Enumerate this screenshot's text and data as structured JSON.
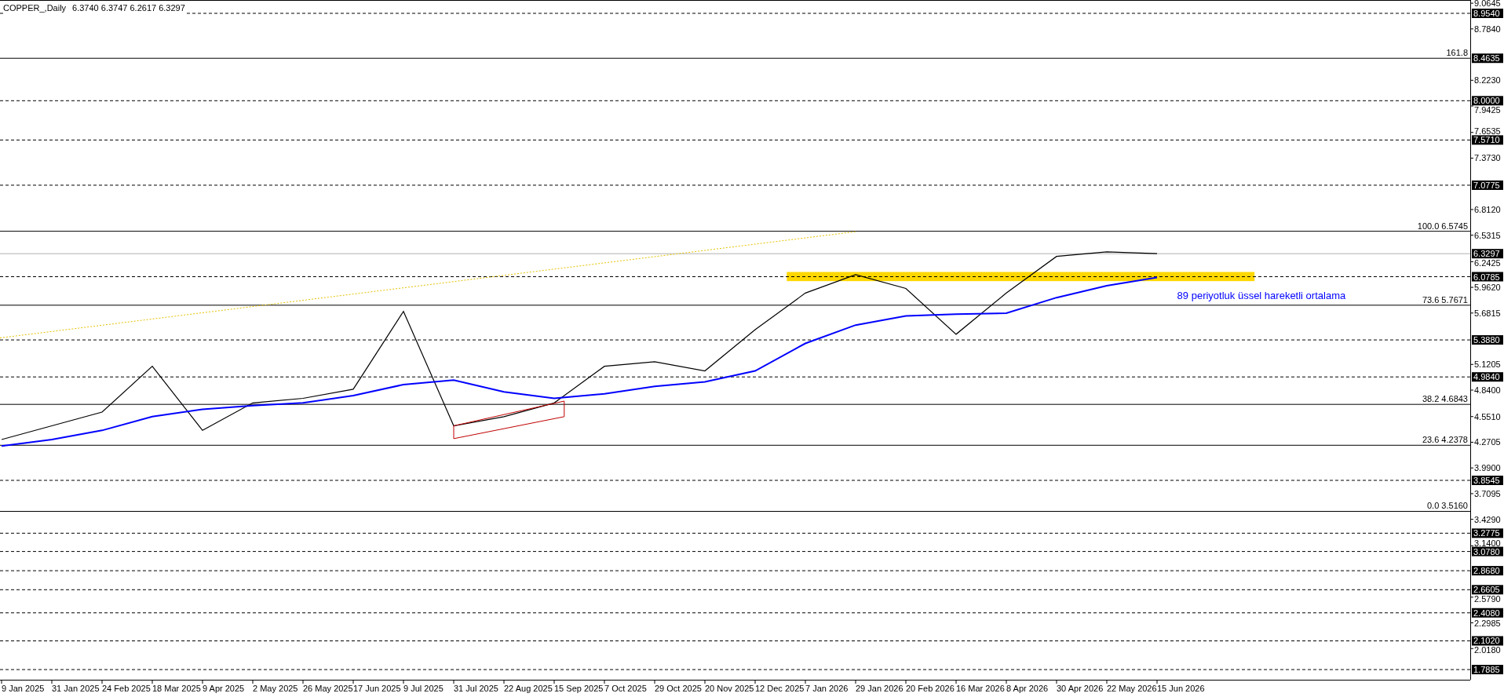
{
  "header": {
    "symbol": "COPPER_,Daily",
    "ohlc": "6.3740 6.3747 6.2617 6.3297"
  },
  "chart_data": {
    "type": "line",
    "categories": [
      "9 Jan 2025",
      "31 Jan 2025",
      "24 Feb 2025",
      "18 Mar 2025",
      "9 Apr 2025",
      "2 May 2025",
      "26 May 2025",
      "17 Jun 2025",
      "9 Jul 2025",
      "31 Jul 2025",
      "22 Aug 2025",
      "15 Sep 2025",
      "7 Oct 2025",
      "29 Oct 2025",
      "20 Nov 2025",
      "12 Dec 2025",
      "7 Jan 2026",
      "29 Jan 2026",
      "20 Feb 2026",
      "16 Mar 2026",
      "8 Apr 2026",
      "30 Apr 2026",
      "22 May 2026",
      "15 Jun 2026"
    ],
    "series": [
      {
        "color": "#000000",
        "values": [
          4.3,
          4.45,
          4.6,
          5.1,
          4.4,
          4.7,
          4.75,
          4.85,
          5.7,
          4.45,
          4.55,
          4.7,
          5.1,
          5.15,
          5.05,
          5.5,
          5.9,
          6.1,
          5.95,
          5.45,
          5.9,
          6.3,
          6.35,
          6.33
        ]
      },
      {
        "color": "#0000ff",
        "values": [
          4.23,
          4.3,
          4.4,
          4.55,
          4.63,
          4.67,
          4.7,
          4.78,
          4.9,
          4.95,
          4.82,
          4.75,
          4.8,
          4.88,
          4.93,
          5.05,
          5.35,
          5.55,
          5.65,
          5.67,
          5.68,
          5.85,
          5.98,
          6.07
        ]
      }
    ],
    "ylim": [
      1.6775,
      9.0997
    ],
    "yticks": [
      {
        "value": 9.0645,
        "label": "9.0645"
      },
      {
        "value": 8.784,
        "label": "8.7840"
      },
      {
        "value": 8.223,
        "label": "8.2230"
      },
      {
        "value": 7.9425,
        "label": "7.9425"
      },
      {
        "value": 7.6535,
        "label": "7.6535"
      },
      {
        "value": 7.373,
        "label": "7.3730"
      },
      {
        "value": 6.812,
        "label": "6.8120"
      },
      {
        "value": 6.5315,
        "label": "6.5315"
      },
      {
        "value": 6.2425,
        "label": "6.2425"
      },
      {
        "value": 5.962,
        "label": "5.9620"
      },
      {
        "value": 5.6815,
        "label": "5.6815"
      },
      {
        "value": 5.1205,
        "label": "5.1205"
      },
      {
        "value": 4.84,
        "label": "4.8400"
      },
      {
        "value": 4.551,
        "label": "4.5510"
      },
      {
        "value": 4.2705,
        "label": "4.2705"
      },
      {
        "value": 3.99,
        "label": "3.9900"
      },
      {
        "value": 3.7095,
        "label": "3.7095"
      },
      {
        "value": 3.429,
        "label": "3.4290"
      },
      {
        "value": 3.14,
        "label": "3.1400"
      },
      {
        "value": 2.579,
        "label": "2.5790"
      },
      {
        "value": 2.2985,
        "label": "2.2985"
      },
      {
        "value": 2.018,
        "label": "2.0180"
      }
    ],
    "ref_lines": [
      {
        "axis": "y",
        "value": 8.954,
        "label": "8.9540"
      },
      {
        "axis": "y",
        "value": 8.4635,
        "label": "8.4635"
      },
      {
        "axis": "y",
        "value": 8.0,
        "label": "8.0000"
      },
      {
        "axis": "y",
        "value": 7.571,
        "label": "7.5710"
      },
      {
        "axis": "y",
        "value": 7.0775,
        "label": "7.0775"
      },
      {
        "axis": "y",
        "value": 6.5745,
        "label": "100.0 6.5745"
      },
      {
        "axis": "y",
        "value": 6.3297,
        "label": "6.3297",
        "color": "#b0b0b0"
      },
      {
        "axis": "y",
        "value": 6.0785,
        "label": "6.0785"
      },
      {
        "axis": "y",
        "value": 5.7671,
        "label": "73.6 5.7671"
      },
      {
        "axis": "y",
        "value": 5.388,
        "label": "5.3880"
      },
      {
        "axis": "y",
        "value": 4.984,
        "label": "4.9840"
      },
      {
        "axis": "y",
        "value": 4.6843,
        "label": "38.2 4.6843"
      },
      {
        "axis": "y",
        "value": 4.2378,
        "label": "23.6 4.2378"
      },
      {
        "axis": "y",
        "value": 3.8545,
        "label": "3.8545"
      },
      {
        "axis": "y",
        "value": 3.516,
        "label": "0.0 3.5160"
      },
      {
        "axis": "y",
        "value": 3.2775,
        "label": "3.2775"
      },
      {
        "axis": "y",
        "value": 3.078,
        "label": "3.0780"
      },
      {
        "axis": "y",
        "value": 2.868,
        "label": "2.8680"
      },
      {
        "axis": "y",
        "value": 2.6605,
        "label": "2.6605"
      },
      {
        "axis": "y",
        "value": 2.408,
        "label": "2.4080"
      },
      {
        "axis": "y",
        "value": 2.102,
        "label": "2.1020"
      },
      {
        "axis": "y",
        "value": 1.7885,
        "label": "1.7885"
      }
    ],
    "bands": [
      {
        "axis": "y",
        "from": 6.03,
        "to": 6.13,
        "color": "#ffd700"
      }
    ],
    "annotations": [
      "161.8",
      "89 periyotluk üssel hareketli ortalama"
    ]
  }
}
